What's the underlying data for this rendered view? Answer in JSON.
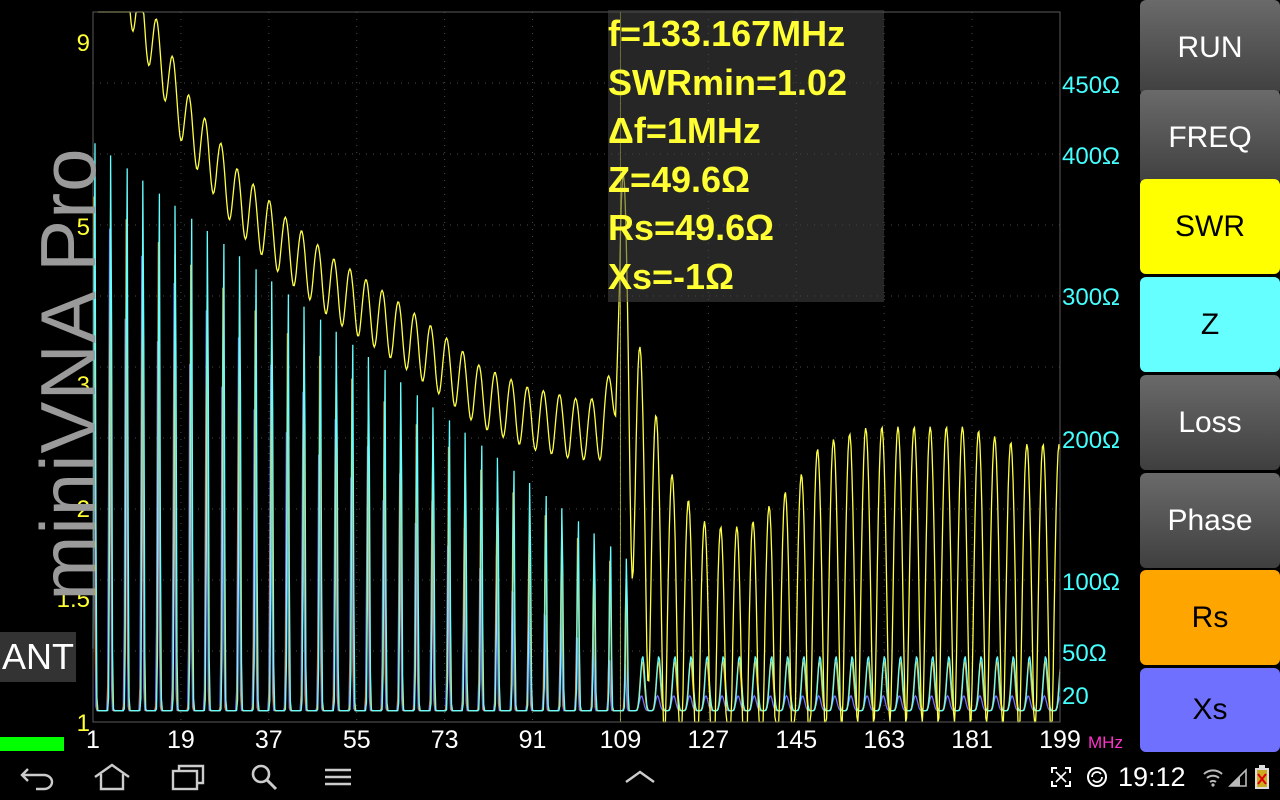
{
  "app": {
    "watermark": "miniVNA Pro",
    "ant_label": "ANT"
  },
  "readout": {
    "lines": [
      "f=133.167MHz",
      "SWRmin=1.02",
      "Δf=1MHz",
      "Z=49.6Ω",
      "Rs=49.6Ω",
      "Xs=-1Ω"
    ]
  },
  "sidebar": {
    "buttons": [
      {
        "label": "RUN",
        "bg": "#505050",
        "fg": "#ffffff"
      },
      {
        "label": "FREQ",
        "bg": "#505050",
        "fg": "#ffffff"
      },
      {
        "label": "SWR",
        "bg": "#ffff00",
        "fg": "#000000"
      },
      {
        "label": "Z",
        "bg": "#66ffff",
        "fg": "#000000"
      },
      {
        "label": "Loss",
        "bg": "#505050",
        "fg": "#ffffff"
      },
      {
        "label": "Phase",
        "bg": "#505050",
        "fg": "#ffffff"
      },
      {
        "label": "Rs",
        "bg": "#ffa500",
        "fg": "#000000"
      },
      {
        "label": "Xs",
        "bg": "#7070ff",
        "fg": "#000000"
      }
    ]
  },
  "colors": {
    "swr": "#ffff44",
    "z": "#66ffff",
    "rs": "#ffa500",
    "xs": "#7070ff",
    "grid": "#4a4a4a",
    "indicator": "#00ff00"
  },
  "status_bar": {
    "time": "19:12",
    "nav_icons": [
      "back-icon",
      "home-icon",
      "recent-apps-icon",
      "search-icon",
      "menu-icon",
      "chevron-up-icon"
    ],
    "status_icons": [
      "screenshot-icon",
      "sync-icon",
      "wifi-icon",
      "signal-icon",
      "battery-icon"
    ]
  },
  "chart_data": {
    "type": "line",
    "x_unit": "MHz",
    "x_ticks": [
      "1",
      "19",
      "37",
      "55",
      "73",
      "91",
      "109",
      "127",
      "145",
      "163",
      "181",
      "199"
    ],
    "xlim": [
      1,
      199
    ],
    "y_left_label": "SWR",
    "y_left_scale": "log-swr",
    "y_left_ticks": [
      "1",
      "1.5",
      "2",
      "3",
      "5",
      "9"
    ],
    "y_right_ticks": [
      "20",
      "50Ω",
      "100Ω",
      "200Ω",
      "300Ω",
      "400Ω",
      "450Ω"
    ],
    "marker": {
      "x": 109
    },
    "series": [
      {
        "name": "SWR",
        "axis": "left",
        "trend_x": [
          1,
          5,
          10,
          20,
          30,
          40,
          50,
          60,
          70,
          80,
          90,
          100,
          105,
          108,
          109,
          112,
          115,
          120,
          127,
          135,
          145,
          150,
          160,
          170,
          180,
          190,
          199
        ],
        "trend_y": [
          30,
          12,
          10,
          7,
          5.5,
          4.7,
          4.1,
          3.7,
          3.3,
          2.9,
          2.7,
          2.6,
          2.6,
          3.0,
          4.5,
          2.5,
          2.0,
          1.5,
          1.3,
          1.3,
          1.5,
          1.7,
          1.8,
          1.8,
          1.8,
          1.7,
          1.7
        ]
      },
      {
        "name": "Z",
        "axis": "right",
        "peak_x_start": 3,
        "peak_spacing": 3.3,
        "peak_max": 420,
        "peak_min": 110
      },
      {
        "name": "Rs",
        "axis": "right",
        "peak_x_start": 3,
        "peak_spacing": 3.3,
        "peak_max": 380,
        "peak_min": 100
      },
      {
        "name": "Xs",
        "axis": "right",
        "peak_x_start": 3,
        "peak_spacing": 3.3,
        "peak_max": 350,
        "peak_min": 30
      }
    ]
  }
}
